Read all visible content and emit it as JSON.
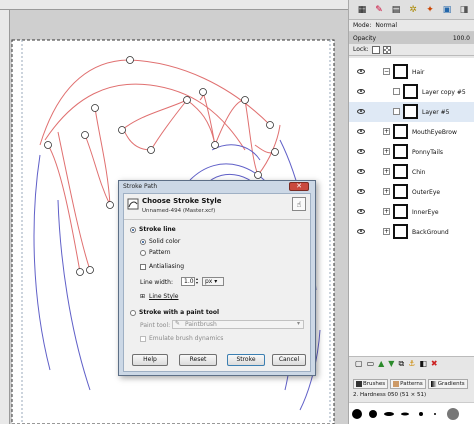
{
  "dock": {
    "mode_label": "Mode:",
    "mode_value": "Normal",
    "opacity_label": "Opacity",
    "opacity_value": "100.0",
    "lock_label": "Lock:",
    "layers": [
      {
        "name": "Hair",
        "indent": 0,
        "selected": false
      },
      {
        "name": "Layer copy #5",
        "indent": 1,
        "selected": false
      },
      {
        "name": "Layer #5",
        "indent": 1,
        "selected": true
      },
      {
        "name": "MouthEyeBrow",
        "indent": 0,
        "selected": false
      },
      {
        "name": "PonnyTails",
        "indent": 0,
        "selected": false
      },
      {
        "name": "Chin",
        "indent": 0,
        "selected": false
      },
      {
        "name": "OuterEye",
        "indent": 0,
        "selected": false
      },
      {
        "name": "InnerEye",
        "indent": 0,
        "selected": false
      },
      {
        "name": "BackGround",
        "indent": 0,
        "selected": false
      }
    ],
    "brush_tabs": [
      "Brushes",
      "Patterns",
      "Gradients"
    ],
    "brush_info": "2. Hardness 050 (51 × 51)"
  },
  "dialog": {
    "window_title": "Stroke Path",
    "close_glyph": "✕",
    "heading": "Choose Stroke Style",
    "subheading": "Unnamed-494 (Master.xcf)",
    "stroke_line": "Stroke line",
    "solid_color": "Solid color",
    "pattern": "Pattern",
    "antialiasing": "Antialiasing",
    "line_width_label": "Line width:",
    "line_width_value": "1.0",
    "line_width_unit": "px",
    "line_style": "Line Style",
    "stroke_paint_tool": "Stroke with a paint tool",
    "paint_tool_label": "Paint tool:",
    "paint_tool_value": "Paintbrush",
    "emulate_dynamics": "Emulate brush dynamics",
    "buttons": {
      "help": "Help",
      "reset": "Reset",
      "stroke": "Stroke",
      "cancel": "Cancel"
    }
  }
}
